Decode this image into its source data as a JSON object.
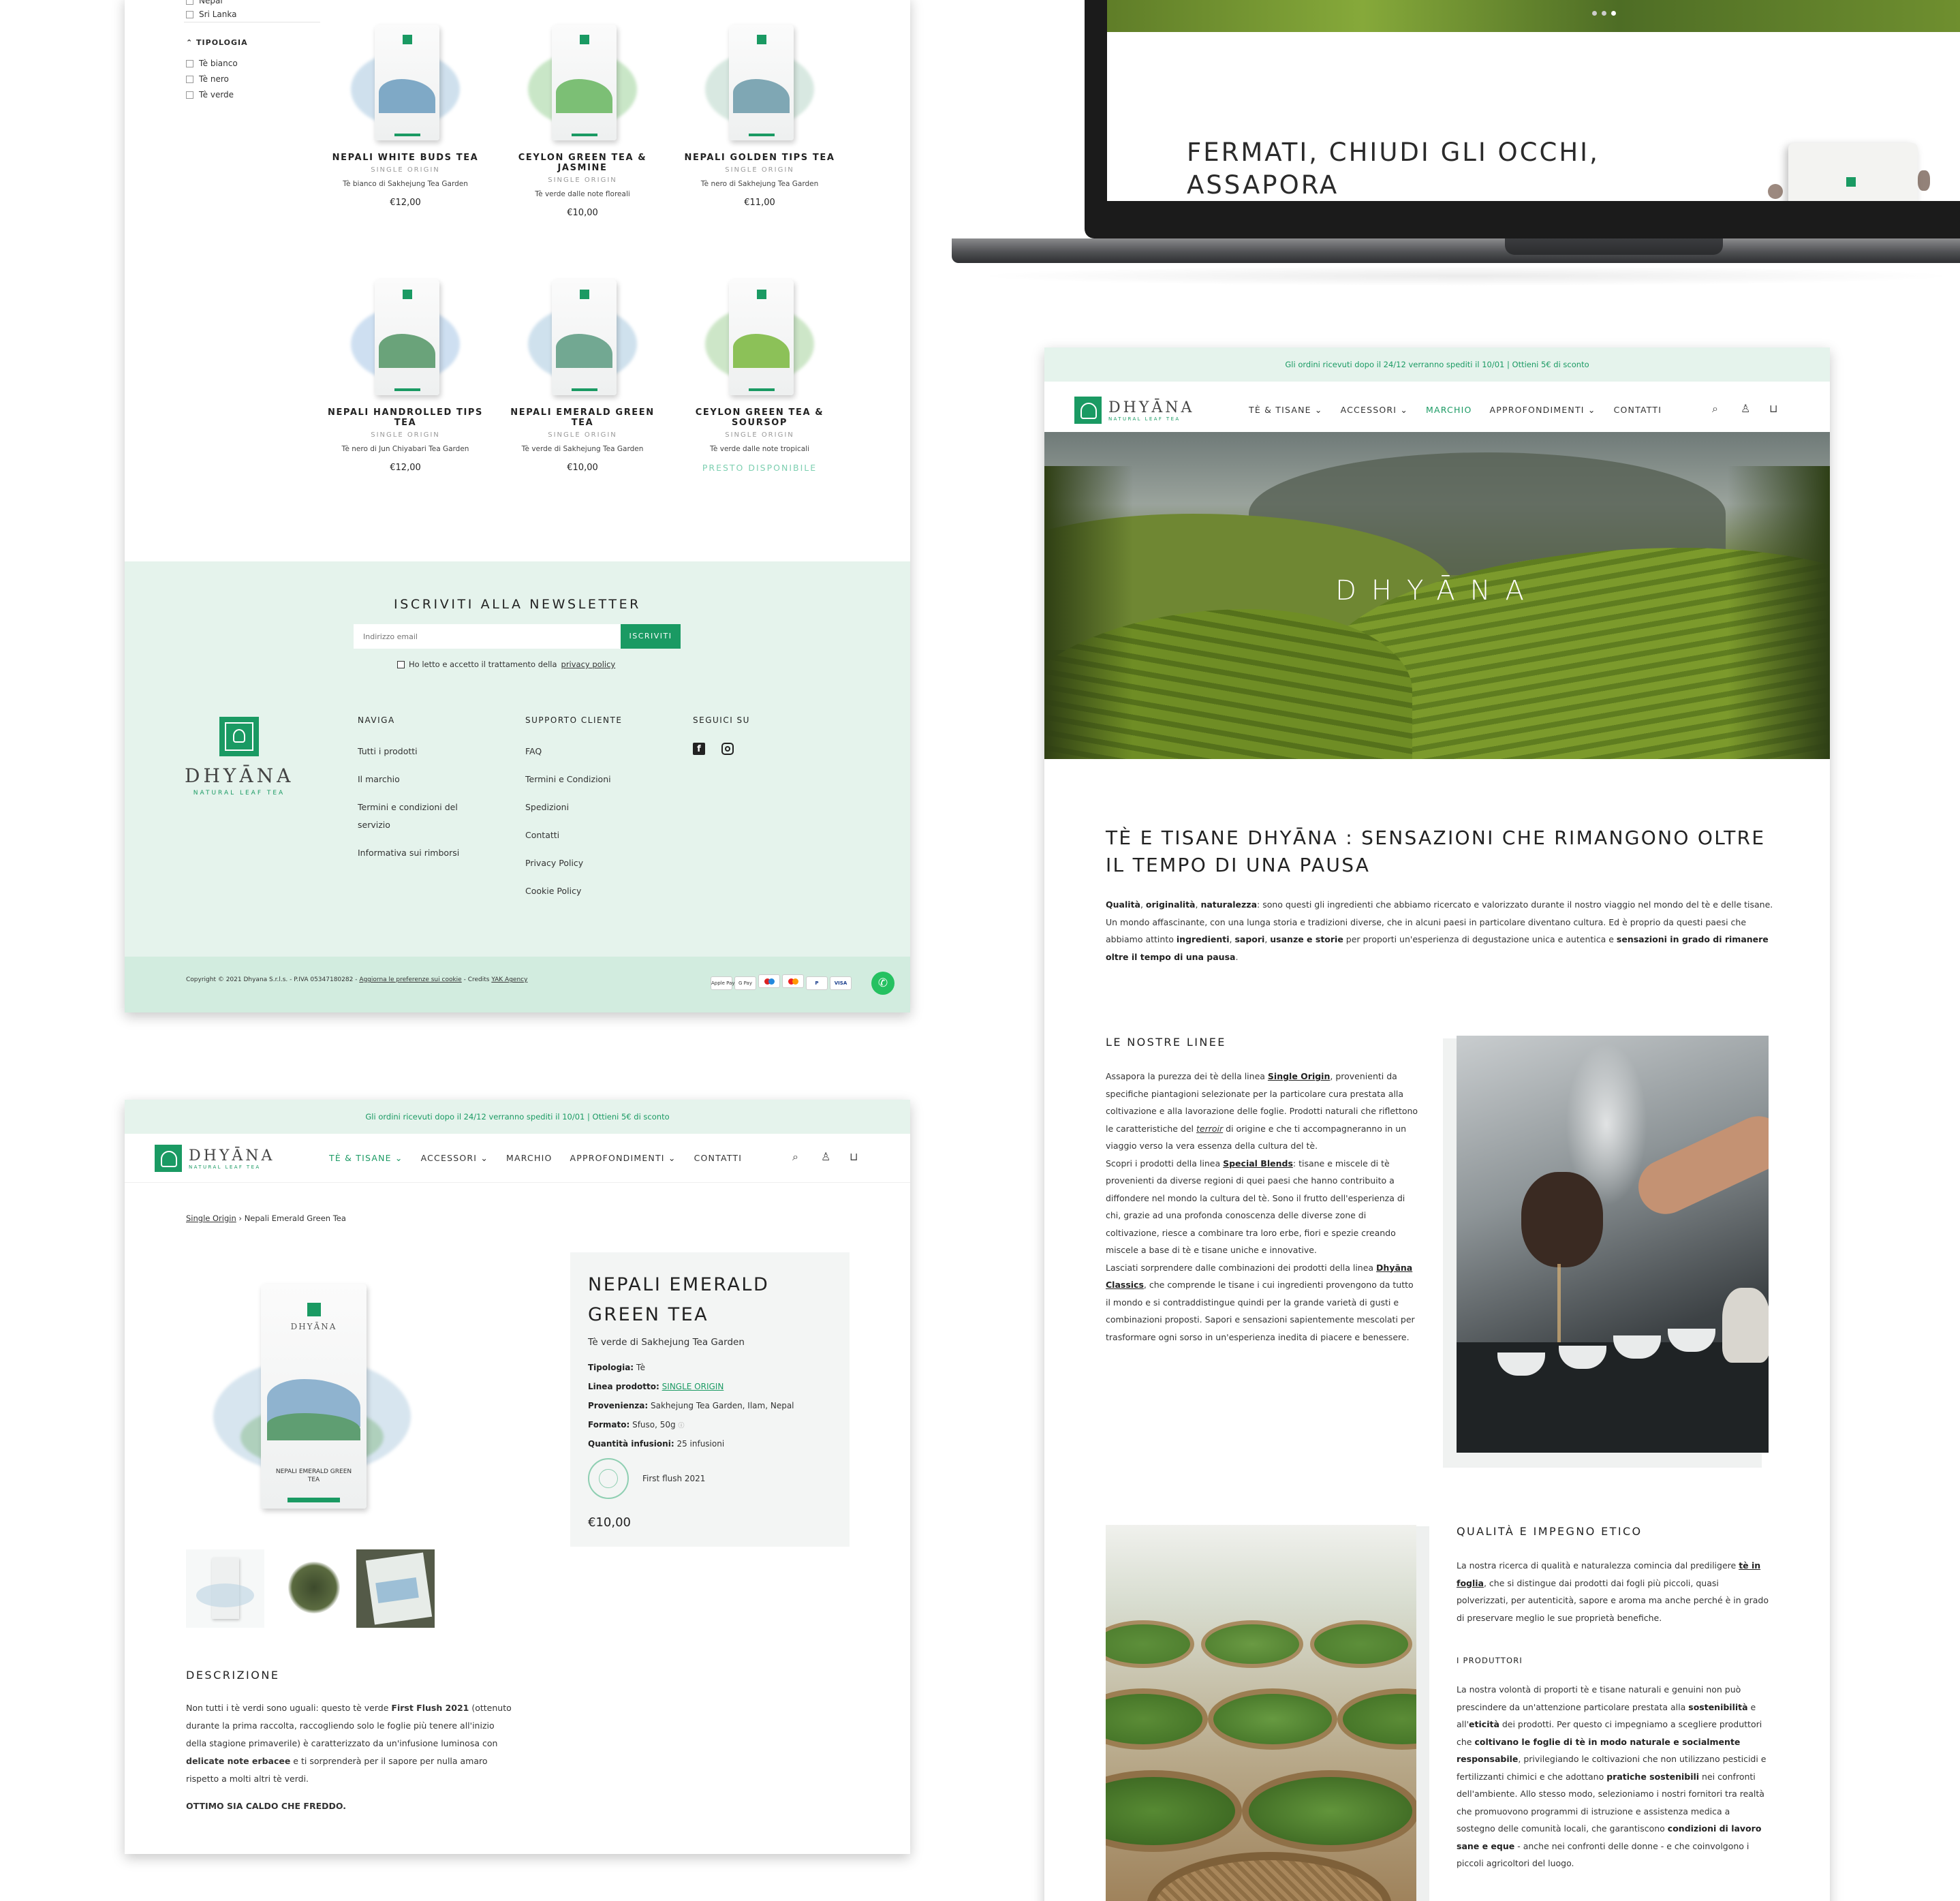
{
  "colors": {
    "brand": "#1a9a63",
    "mint": "#e5f3ec",
    "mint_dark": "#d2ecdf"
  },
  "shop": {
    "filters": {
      "origins": [
        "Nepal",
        "Sri Lanka"
      ],
      "type_heading": "TIPOLOGIA",
      "types": [
        "Tè bianco",
        "Tè nero",
        "Tè verde"
      ]
    },
    "products": [
      {
        "name": "NEPALI WHITE BUDS TEA",
        "line": "SINGLE ORIGIN",
        "desc": "Tè bianco di Sakhejung Tea Garden",
        "price": "€12,00"
      },
      {
        "name": "CEYLON GREEN TEA & JASMINE",
        "line": "SINGLE ORIGIN",
        "desc": "Tè verde dalle note floreali",
        "price": "€10,00"
      },
      {
        "name": "NEPALI GOLDEN TIPS TEA",
        "line": "SINGLE ORIGIN",
        "desc": "Tè nero di Sakhejung Tea Garden",
        "price": "€11,00"
      },
      {
        "name": "NEPALI HANDROLLED TIPS TEA",
        "line": "SINGLE ORIGIN",
        "desc": "Tè nero di Jun Chiyabari Tea Garden",
        "price": "€12,00"
      },
      {
        "name": "NEPALI EMERALD GREEN TEA",
        "line": "SINGLE ORIGIN",
        "desc": "Tè verde di Sakhejung Tea Garden",
        "price": "€10,00"
      },
      {
        "name": "CEYLON GREEN TEA & SOURSOP",
        "line": "SINGLE ORIGIN",
        "desc": "Tè verde dalle note tropicali",
        "availability": "PRESTO DISPONIBILE"
      }
    ],
    "newsletter": {
      "title": "ISCRIVITI ALLA NEWSLETTER",
      "placeholder": "Indirizzo email",
      "button": "ISCRIVITI",
      "consent_prefix": "Ho letto e accetto il trattamento della",
      "consent_link": "privacy policy"
    },
    "footer": {
      "brand": "DHYĀNA",
      "tagline": "NATURAL LEAF TEA",
      "naviga": {
        "title": "NAVIGA",
        "links": [
          "Tutti i prodotti",
          "Il marchio",
          "Termini e condizioni del servizio",
          "Informativa sui rimborsi"
        ]
      },
      "supporto": {
        "title": "SUPPORTO CLIENTE",
        "links": [
          "FAQ",
          "Termini e Condizioni",
          "Spedizioni",
          "Contatti",
          "Privacy Policy",
          "Cookie Policy"
        ]
      },
      "social": {
        "title": "SEGUICI SU"
      },
      "copyright": "Copyright © 2021 Dhyana S.r.l.s. - P.IVA 05347180282 - ",
      "cookie_link": "Aggiorna le preferenze sui cookie",
      "credits_prefix": " - Credits ",
      "credits_link": "YAK Agency",
      "payments": [
        "Apple Pay",
        "G Pay",
        "Maestro",
        "Mastercard",
        "PayPal",
        "VISA"
      ]
    }
  },
  "laptop": {
    "headline_line1": "FERMATI, CHIUDI GLI OCCHI,",
    "headline_line2": "ASSAPORA"
  },
  "site": {
    "banner": "Gli ordini ricevuti dopo il 24/12 verranno spediti il 10/01 | Ottieni 5€ di sconto",
    "brand": "DHYĀNA",
    "tagline": "NATURAL LEAF TEA",
    "nav": [
      "TÈ & TISANE",
      "ACCESSORI",
      "MARCHIO",
      "APPROFONDIMENTI",
      "CONTATTI"
    ]
  },
  "product_page": {
    "breadcrumb_link": "Single Origin",
    "breadcrumb_current": "Nepali Emerald Green Tea",
    "title": "NEPALI EMERALD GREEN TEA",
    "subtitle": "Tè verde di Sakhejung Tea Garden",
    "specs": [
      {
        "label": "Tipologia:",
        "value": "Tè"
      },
      {
        "label": "Linea prodotto:",
        "value": "SINGLE ORIGIN"
      },
      {
        "label": "Provenienza:",
        "value": "Sakhejung Tea Garden, Ilam, Nepal"
      },
      {
        "label": "Formato:",
        "value": "Sfuso, 50g"
      },
      {
        "label": "Quantità infusioni:",
        "value": "25 infusioni"
      }
    ],
    "flush": "First flush 2021",
    "price": "€10,00",
    "pouch_text": "NEPALI EMERALD GREEN TEA",
    "desc_title": "DESCRIZIONE",
    "desc_p1_a": "Non tutti i tè verdi sono uguali: questo tè verde ",
    "desc_p1_b": "First Flush 2021",
    "desc_p1_c": " (ottenuto durante la prima raccolta, raccogliendo solo le foglie più tenere all'inizio della stagione primaverile) è caratterizzato da un'infusione luminosa con ",
    "desc_p1_d": "delicate note erbacee",
    "desc_p1_e": " e ti sorprenderà per il sapore per nulla amaro rispetto a molti altri tè verdi.",
    "desc_p2": "OTTIMO SIA CALDO CHE FREDDO."
  },
  "brand_page": {
    "hero": "DHYĀNA",
    "title": "TÈ E TISANE DHYĀNA : SENSAZIONI CHE RIMANGONO OLTRE IL TEMPO DI UNA PAUSA",
    "intro_b1": "Qualità",
    "intro_b2": "originalità",
    "intro_b3": "naturalezza",
    "intro_t1": ": sono questi gli ingredienti che abbiamo ricercato e valorizzato durante il nostro viaggio nel mondo del tè e delle tisane. Un mondo affascinante, con una lunga storia e tradizioni diverse, che in alcuni paesi in particolare diventano cultura. Ed è proprio da questi paesi che abbiamo attinto ",
    "intro_b4": "ingredienti",
    "intro_b5": "sapori",
    "intro_b6": "usanze e storie",
    "intro_t2": " per proporti un'esperienza di degustazione unica e autentica e ",
    "intro_b7": "sensazioni in grado di rimanere oltre il tempo di una pausa",
    "lines_title": "LE NOSTRE LINEE",
    "lines_p1_a": "Assapora la purezza dei tè della linea ",
    "lines_p1_link": "Single Origin",
    "lines_p1_b": ", provenienti da specifiche piantagioni selezionate per la particolare cura prestata alla coltivazione e alla lavorazione delle foglie. Prodotti naturali che riflettono le caratteristiche del ",
    "lines_p1_terroir": "terroir",
    "lines_p1_c": " di origine e che ti accompagneranno in un viaggio verso la vera essenza della cultura del tè.",
    "lines_p2_a": "Scopri i prodotti della linea ",
    "lines_p2_link": "Special Blends",
    "lines_p2_b": ": tisane e miscele di tè provenienti da diverse regioni di quei paesi che hanno contribuito a diffondere nel mondo la cultura del tè. Sono il frutto dell'esperienza di chi, grazie ad una profonda conoscenza delle diverse zone di coltivazione, riesce a combinare tra loro erbe, fiori e spezie creando miscele a base di tè e tisane uniche e innovative.",
    "lines_p3_a": "Lasciati sorprendere dalle combinazioni dei prodotti della linea ",
    "lines_p3_link": "Dhyāna Classics",
    "lines_p3_b": ", che comprende le tisane i cui ingredienti provengono da tutto il mondo e si contraddistingue quindi per la grande varietà di gusti e combinazioni proposti. Sapori e sensazioni sapientemente mescolati per trasformare ogni sorso in un'esperienza inedita di piacere e benessere.",
    "quality_title": "QUALITÀ E IMPEGNO ETICO",
    "quality_p1_a": "La nostra ricerca di qualità e naturalezza comincia dal prediligere ",
    "quality_p1_link": "tè in foglia",
    "quality_p1_b": ", che si distingue dai prodotti dai fogli più piccoli, quasi polverizzati, per autenticità, sapore e aroma ma anche perché è in grado di preservare meglio le sue proprietà benefiche.",
    "producers_title": "I PRODUTTORI",
    "prod_a": "La nostra volontà di proporti tè e tisane naturali e genuini non può prescindere da un'attenzione particolare prestata alla ",
    "prod_b1": "sostenibilità",
    "prod_c": " e all'",
    "prod_b2": "eticità",
    "prod_d": " dei prodotti. Per questo ci impegniamo a scegliere produttori che ",
    "prod_b3": "coltivano le foglie di tè in modo naturale e socialmente responsabile",
    "prod_e": ", privilegiando le coltivazioni che non utilizzano pesticidi e fertilizzanti chimici e che adottano ",
    "prod_b4": "pratiche sostenibili",
    "prod_f": " nei confronti dell'ambiente. Allo stesso modo, selezioniamo i nostri fornitori tra realtà che promuovono programmi di istruzione e assistenza medica a sostegno delle comunità locali, che garantiscono ",
    "prod_b5": "condizioni di lavoro sane e eque",
    "prod_g": " - anche nei confronti delle donne - e che coinvolgono i piccoli agricoltori del luogo."
  }
}
